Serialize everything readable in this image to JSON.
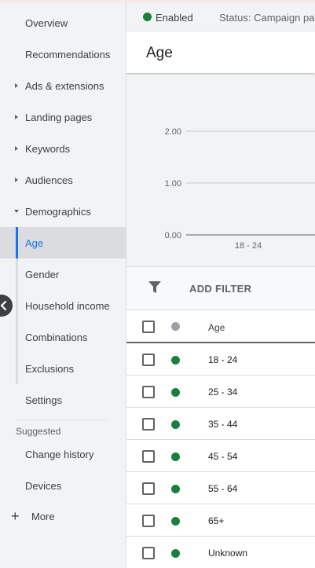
{
  "sidebar": {
    "items": [
      {
        "label": "Overview"
      },
      {
        "label": "Recommendations"
      },
      {
        "label": "Ads & extensions"
      },
      {
        "label": "Landing pages"
      },
      {
        "label": "Keywords"
      },
      {
        "label": "Audiences"
      },
      {
        "label": "Demographics"
      },
      {
        "label": "Age"
      },
      {
        "label": "Gender"
      },
      {
        "label": "Household income"
      },
      {
        "label": "Combinations"
      },
      {
        "label": "Exclusions"
      },
      {
        "label": "Settings"
      }
    ],
    "suggested_title": "Suggested",
    "suggested": [
      {
        "label": "Change history"
      },
      {
        "label": "Devices"
      }
    ],
    "more_label": "More",
    "plus_glyph": "+"
  },
  "status": {
    "enabled_label": "Enabled",
    "status_text": "Status: Campaign paused"
  },
  "page": {
    "title": "Age"
  },
  "chart_data": {
    "type": "bar",
    "categories": [
      "18 - 24"
    ],
    "values": [
      0
    ],
    "yticks": [
      "2.00",
      "1.00",
      "0.00"
    ],
    "ylim": [
      0,
      2
    ],
    "grid": true
  },
  "filter": {
    "add_label": "ADD FILTER"
  },
  "table": {
    "header": "Age",
    "rows": [
      "18 - 24",
      "25 - 34",
      "35 - 44",
      "45 - 54",
      "55 - 64",
      "65+",
      "Unknown"
    ]
  },
  "colors": {
    "enabled": "#188038",
    "accent": "#1a73e8",
    "sidebar_bg": "#f1f3f4"
  }
}
